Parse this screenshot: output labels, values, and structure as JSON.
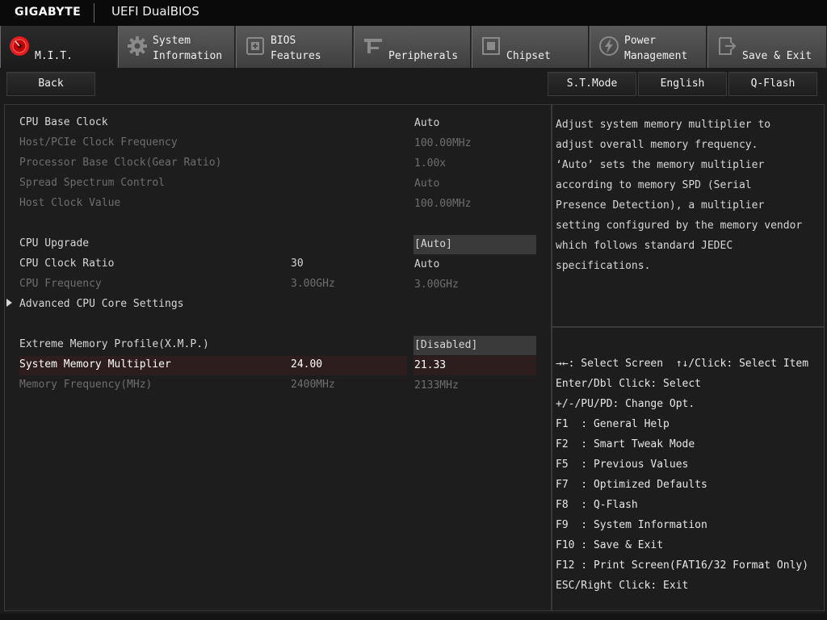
{
  "brand": {
    "logo_text": "GIGABYTE",
    "product": "UEFI DualBIOS"
  },
  "tabs": [
    {
      "line1": "",
      "line2": "M.I.T.",
      "icon": "mit-gauge-icon",
      "active": true
    },
    {
      "line1": "System",
      "line2": "Information",
      "icon": "gear-icon"
    },
    {
      "line1": "BIOS",
      "line2": "Features",
      "icon": "bios-chip-icon"
    },
    {
      "line1": "",
      "line2": "Peripherals",
      "icon": "peripherals-icon"
    },
    {
      "line1": "",
      "line2": "Chipset",
      "icon": "chipset-icon"
    },
    {
      "line1": "Power",
      "line2": "Management",
      "icon": "power-icon"
    },
    {
      "line1": "",
      "line2": "Save & Exit",
      "icon": "exit-door-icon"
    }
  ],
  "toolbar": {
    "back": "Back",
    "st_mode": "S.T.Mode",
    "language": "English",
    "qflash": "Q-Flash"
  },
  "settings": [
    {
      "label": "CPU Base Clock",
      "current": "",
      "value": "Auto",
      "state": "normal"
    },
    {
      "label": "Host/PCIe Clock Frequency",
      "current": "",
      "value": "100.00MHz",
      "state": "dim"
    },
    {
      "label": "Processor Base Clock(Gear Ratio)",
      "current": "",
      "value": "1.00x",
      "state": "dim"
    },
    {
      "label": "Spread Spectrum Control",
      "current": "",
      "value": "Auto",
      "state": "dim"
    },
    {
      "label": "Host Clock Value",
      "current": "",
      "value": "100.00MHz",
      "state": "dim"
    },
    {
      "label": "CPU Upgrade",
      "current": "",
      "value": "[Auto]",
      "state": "normal"
    },
    {
      "label": "CPU Clock Ratio",
      "current": "30",
      "value": "Auto",
      "state": "normal"
    },
    {
      "label": "CPU Frequency",
      "current": "3.00GHz",
      "value": "3.00GHz",
      "state": "dim"
    },
    {
      "label": "Advanced CPU Core Settings",
      "current": "",
      "value": "",
      "state": "normal"
    },
    {
      "label": "Extreme Memory Profile(X.M.P.)",
      "current": "",
      "value": "[Disabled]",
      "state": "normal"
    },
    {
      "label": "System Memory Multiplier",
      "current": "24.00",
      "value": "21.33",
      "state": "selected"
    },
    {
      "label": "Memory Frequency(MHz)",
      "current": "2400MHz",
      "value": "2133MHz",
      "state": "dim"
    }
  ],
  "help": {
    "text": "Adjust system memory multiplier to\nadjust overall memory frequency.\n‘Auto’ sets the memory multiplier\naccording to memory SPD (Serial\nPresence Detection), a multiplier\nsetting configured by the memory vendor\nwhich follows standard JEDEC\nspecifications."
  },
  "keys": [
    "→←: Select Screen  ↑↓/Click: Select Item",
    "Enter/Dbl Click: Select",
    "+/-/PU/PD: Change Opt.",
    "F1  : General Help",
    "F2  : Smart Tweak Mode",
    "F5  : Previous Values",
    "F7  : Optimized Defaults",
    "F8  : Q-Flash",
    "F9  : System Information",
    "F10 : Save & Exit",
    "F12 : Print Screen(FAT16/32 Format Only)",
    "ESC/Right Click: Exit"
  ],
  "colors": {
    "accent_red": "#e41e1e",
    "selected_row": "#2d1d1d",
    "dim_text": "#6e6e6e"
  }
}
